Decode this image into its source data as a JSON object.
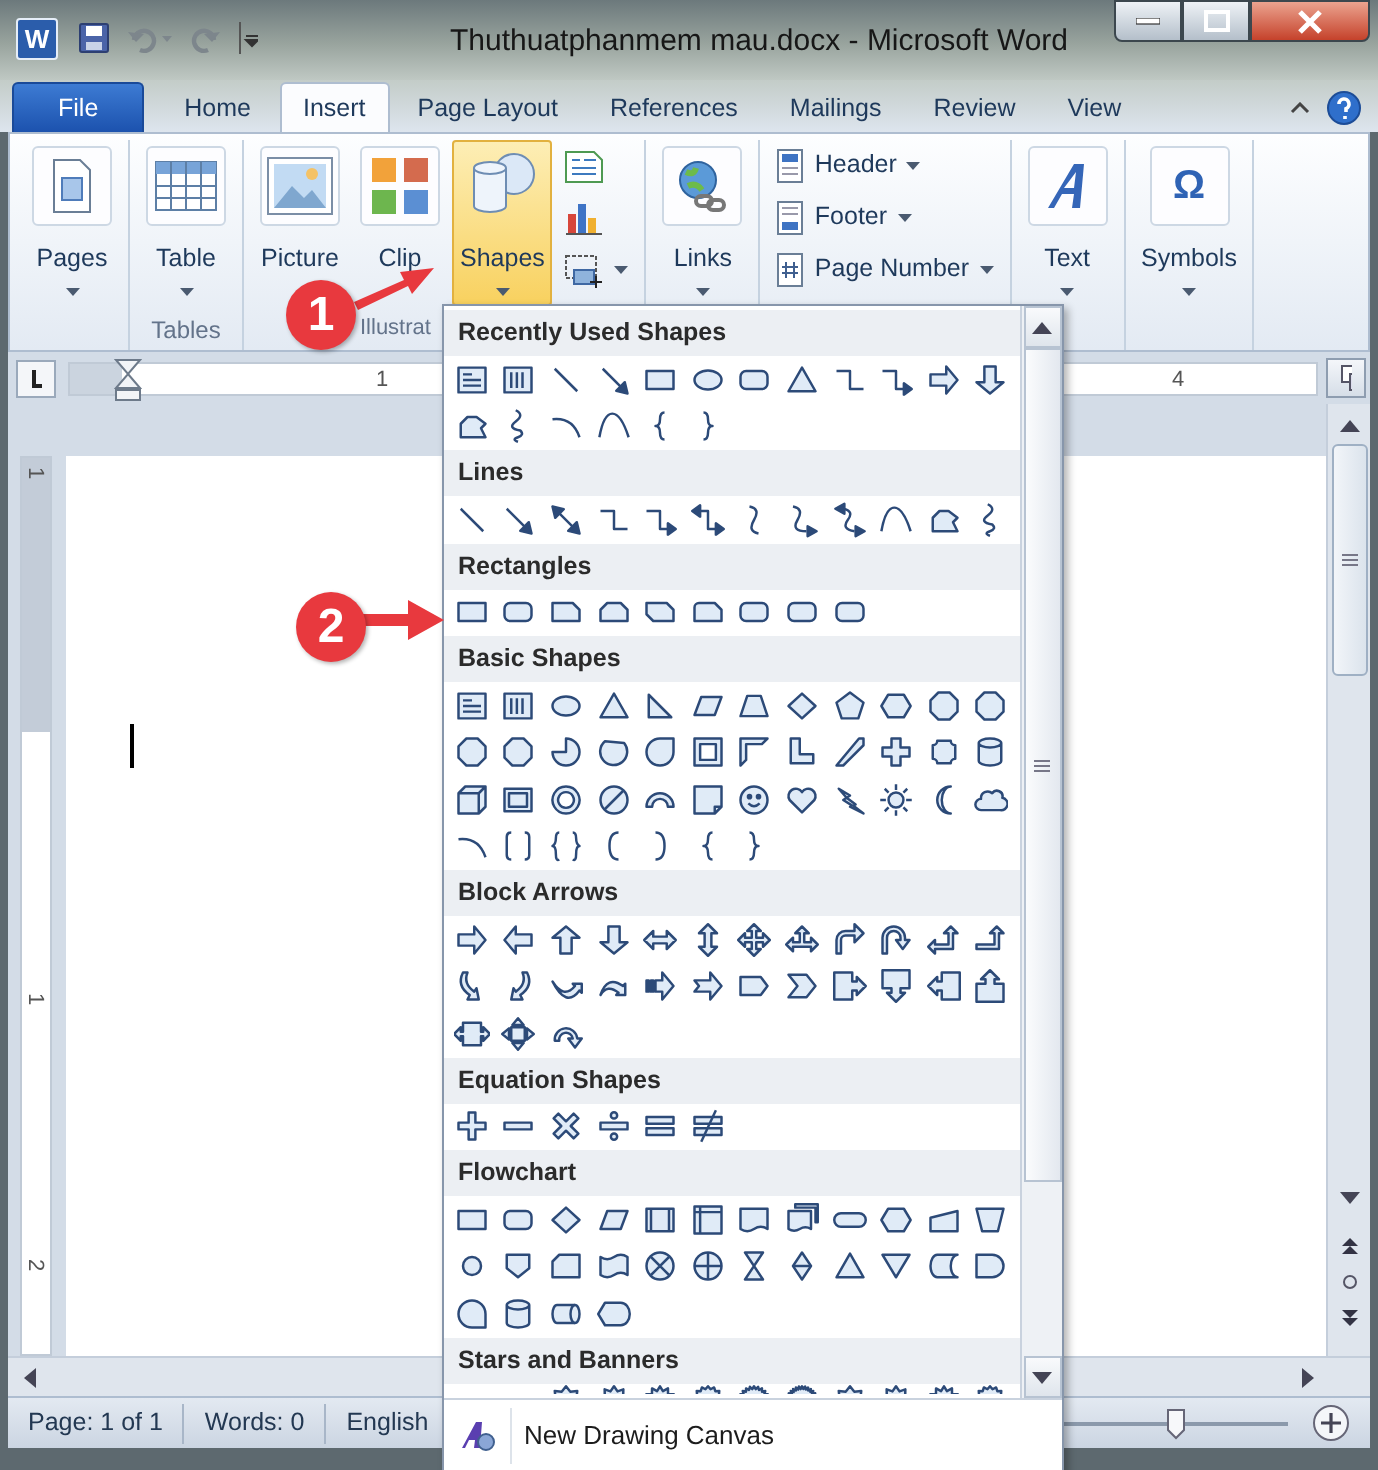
{
  "window": {
    "app_icon": "W",
    "title": "Thuthuatphanmem mau.docx  -  Microsoft Word"
  },
  "tabs": [
    {
      "label": "File",
      "kind": "file",
      "selected": false
    },
    {
      "label": "Home",
      "kind": "tab",
      "selected": false
    },
    {
      "label": "Insert",
      "kind": "tab",
      "selected": true
    },
    {
      "label": "Page Layout",
      "kind": "tab",
      "selected": false
    },
    {
      "label": "References",
      "kind": "tab",
      "selected": false
    },
    {
      "label": "Mailings",
      "kind": "tab",
      "selected": false
    },
    {
      "label": "Review",
      "kind": "tab",
      "selected": false
    },
    {
      "label": "View",
      "kind": "tab",
      "selected": false
    }
  ],
  "ribbon": {
    "groups": [
      {
        "items": [
          {
            "kind": "big",
            "label": "Pages",
            "dropdown": true,
            "selected": false
          }
        ]
      },
      {
        "label": "Tables",
        "items": [
          {
            "kind": "big",
            "label": "Table",
            "dropdown": true,
            "selected": false
          }
        ]
      },
      {
        "label": "Illustrat",
        "items": [
          {
            "kind": "big",
            "label": "Picture",
            "dropdown": false,
            "selected": false
          },
          {
            "kind": "big",
            "label": "Clip",
            "dropdown": false,
            "selected": false
          },
          {
            "kind": "big",
            "label": "Shapes",
            "dropdown": true,
            "selected": true
          },
          {
            "kind": "stack",
            "icons": [
              {
                "dropdown": false
              },
              {
                "dropdown": false
              },
              {
                "dropdown": true
              }
            ]
          }
        ]
      },
      {
        "items": [
          {
            "kind": "big",
            "label": "Links",
            "dropdown": true,
            "selected": false
          }
        ]
      },
      {
        "items": [
          {
            "kind": "list",
            "entries": [
              {
                "label": "Header",
                "dropdown": true
              },
              {
                "label": "Footer",
                "dropdown": true
              },
              {
                "label": "Page Number",
                "dropdown": true
              }
            ]
          }
        ]
      },
      {
        "items": [
          {
            "kind": "big",
            "label": "Text",
            "dropdown": true,
            "selected": false
          }
        ]
      },
      {
        "items": [
          {
            "kind": "big",
            "glyph": "Ω",
            "label": "Symbols",
            "dropdown": true,
            "selected": false
          }
        ]
      }
    ]
  },
  "ruler": {
    "horizontal_labels": [
      "1",
      "4"
    ],
    "vertical_labels": [
      "1",
      "1",
      "2"
    ]
  },
  "status_bar": {
    "items": [
      "Page: 1 of 1",
      "Words: 0",
      "English"
    ],
    "zoom": {
      "level": 0.52
    }
  },
  "shapes_menu": {
    "sections": [
      {
        "title": "Recently Used Shapes",
        "kind": "recent"
      },
      {
        "title": "Lines",
        "kind": "lines"
      },
      {
        "title": "Rectangles",
        "kind": "rectangles"
      },
      {
        "title": "Basic Shapes",
        "kind": "basic"
      },
      {
        "title": "Block Arrows",
        "kind": "block_arrows"
      },
      {
        "title": "Equation Shapes",
        "kind": "equation"
      },
      {
        "title": "Flowchart",
        "kind": "flowchart"
      },
      {
        "title": "Stars and Banners",
        "kind": "stars"
      }
    ],
    "footer": "New Drawing Canvas"
  },
  "callouts": [
    {
      "label": "1"
    },
    {
      "label": "2"
    }
  ]
}
